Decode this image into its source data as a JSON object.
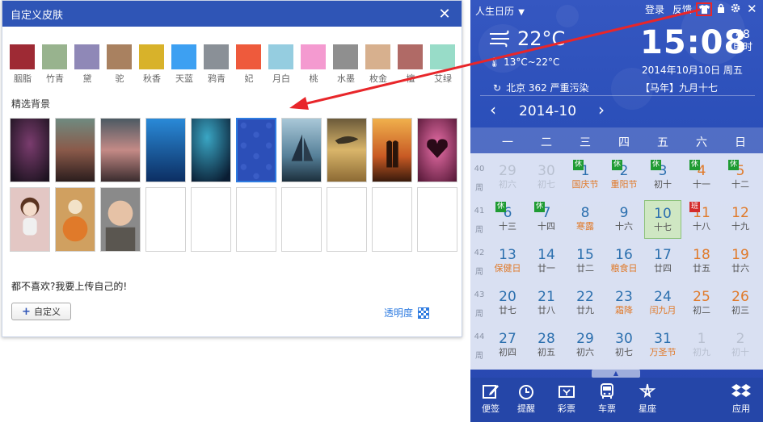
{
  "skin": {
    "title": "自定义皮肤",
    "close": "✕",
    "swatches": [
      {
        "label": "胭脂",
        "color": "#9e2a34"
      },
      {
        "label": "竹青",
        "color": "#98b38e"
      },
      {
        "label": "黛",
        "color": "#8f88b7"
      },
      {
        "label": "驼",
        "color": "#a98160"
      },
      {
        "label": "秋香",
        "color": "#d8b22a"
      },
      {
        "label": "天蓝",
        "color": "#3da0f2"
      },
      {
        "label": "鸦青",
        "color": "#8a9097"
      },
      {
        "label": "妃",
        "color": "#ee5a3c"
      },
      {
        "label": "月白",
        "color": "#95cde0"
      },
      {
        "label": "桃",
        "color": "#f49ad0"
      },
      {
        "label": "水墨",
        "color": "#8f8f8f"
      },
      {
        "label": "枚金",
        "color": "#d7b08e"
      },
      {
        "label": "檀",
        "color": "#b06a66"
      },
      {
        "label": "艾绿",
        "color": "#98dcc8"
      }
    ],
    "section_title": "精选背景",
    "upload_text": "都不喜欢?我要上传自己的!",
    "custom_label": "自定义",
    "opacity_label": "透明度"
  },
  "calendar": {
    "app_name": "人生日历",
    "login": "登录",
    "feedback": "反馈",
    "temperature": "22°C",
    "temp_range": "13°C~22°C",
    "time": "15:08",
    "shichen_num": "48",
    "shichen_label": "申时",
    "date_line": "2014年10月10日 周五",
    "air_quality": "北京 362 严重污染",
    "lunar_line": "【马年】九月十七",
    "month_label": "2014-10",
    "weekdays": [
      "一",
      "二",
      "三",
      "四",
      "五",
      "六",
      "日"
    ],
    "week_label": "周",
    "weeks": [
      {
        "num": "40",
        "days": [
          {
            "n": "29",
            "l": "初六"
          },
          {
            "n": "30",
            "l": "初七"
          },
          {
            "n": "1",
            "l": "国庆节",
            "tag": "休"
          },
          {
            "n": "2",
            "l": "重阳节",
            "tag": "休"
          },
          {
            "n": "3",
            "l": "初十",
            "tag": "休"
          },
          {
            "n": "4",
            "l": "十一",
            "tag": "休"
          },
          {
            "n": "5",
            "l": "十二",
            "tag": "休"
          }
        ]
      },
      {
        "num": "41",
        "days": [
          {
            "n": "6",
            "l": "十三",
            "tag": "休"
          },
          {
            "n": "7",
            "l": "十四",
            "tag": "休"
          },
          {
            "n": "8",
            "l": "寒露"
          },
          {
            "n": "9",
            "l": "十六"
          },
          {
            "n": "10",
            "l": "十七"
          },
          {
            "n": "11",
            "l": "十八",
            "tag": "班"
          },
          {
            "n": "12",
            "l": "十九"
          }
        ]
      },
      {
        "num": "42",
        "days": [
          {
            "n": "13",
            "l": "保健日"
          },
          {
            "n": "14",
            "l": "廿一"
          },
          {
            "n": "15",
            "l": "廿二"
          },
          {
            "n": "16",
            "l": "粮食日"
          },
          {
            "n": "17",
            "l": "廿四"
          },
          {
            "n": "18",
            "l": "廿五"
          },
          {
            "n": "19",
            "l": "廿六"
          }
        ]
      },
      {
        "num": "43",
        "days": [
          {
            "n": "20",
            "l": "廿七"
          },
          {
            "n": "21",
            "l": "廿八"
          },
          {
            "n": "22",
            "l": "廿九"
          },
          {
            "n": "23",
            "l": "霜降"
          },
          {
            "n": "24",
            "l": "闰九月"
          },
          {
            "n": "25",
            "l": "初二"
          },
          {
            "n": "26",
            "l": "初三"
          }
        ]
      },
      {
        "num": "44",
        "days": [
          {
            "n": "27",
            "l": "初四"
          },
          {
            "n": "28",
            "l": "初五"
          },
          {
            "n": "29",
            "l": "初六"
          },
          {
            "n": "30",
            "l": "初七"
          },
          {
            "n": "31",
            "l": "万圣节"
          },
          {
            "n": "1",
            "l": "初九"
          },
          {
            "n": "2",
            "l": "初十"
          }
        ]
      }
    ],
    "tools": [
      {
        "label": "便签",
        "icon": "pencil-icon"
      },
      {
        "label": "提醒",
        "icon": "alarm-clock-icon"
      },
      {
        "label": "彩票",
        "icon": "lottery-ticket-icon"
      },
      {
        "label": "车票",
        "icon": "bus-icon"
      },
      {
        "label": "星座",
        "icon": "star-icon"
      },
      {
        "label": "应用",
        "icon": "dropbox-icon"
      }
    ],
    "colors": {
      "weekend": "#e07a2a",
      "weekday": "#2b6fae",
      "rest_tag": "#1f9b33",
      "work_tag": "#d32b2b"
    }
  }
}
